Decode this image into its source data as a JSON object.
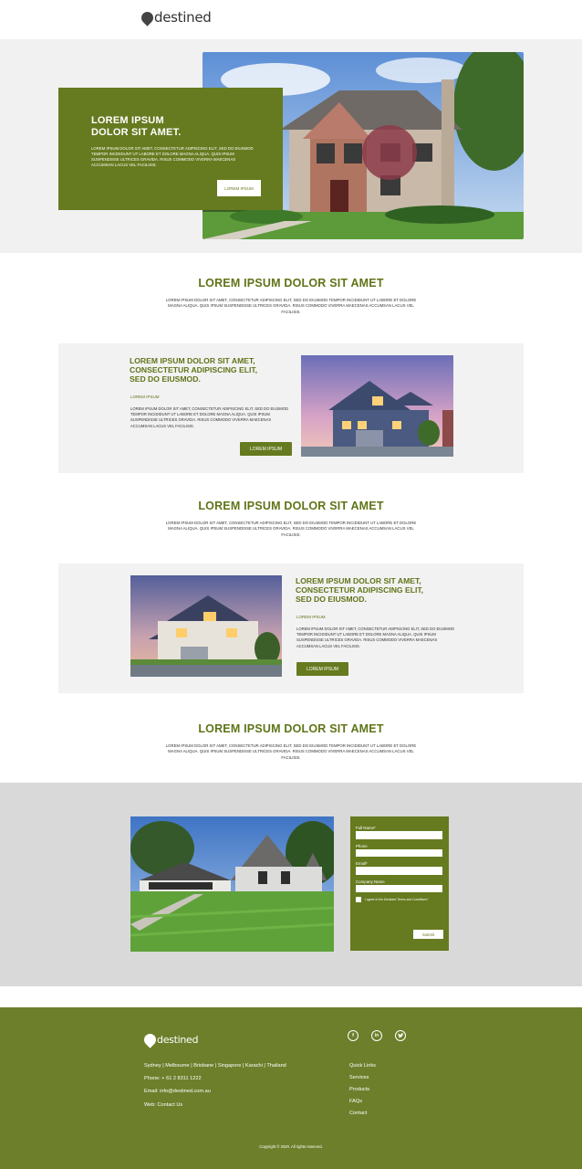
{
  "brand": {
    "logo_letter": "d",
    "logo_text": "estined",
    "color_primary": "#667a1f",
    "color_footer": "#6d7f2b"
  },
  "hero": {
    "title_line1": "LOREM IPSUM",
    "title_line2": "DOLOR SIT AMET.",
    "body": "LOREM IPSUM DOLOR SIT AMET, CONSECTETUR ADIPISCING ELIT, SED DO EIUSMOD TEMPOR INCIDIDUNT UT LABORE ET DOLORE MAGNA ALIQUA. QUIS IPSUM SUSPENDISSE ULTRICES GRAVIDA. RISUS COMMODO VIVERRA MAECENAS ACCUMSAN LACUS VEL FACILISIS.",
    "button": "LOREM IPSUM"
  },
  "section1": {
    "title": "LOREM IPSUM DOLOR SIT AMET",
    "body": "LOREM IPSUM DOLOR SIT AMET, CONSECTETUR ADIPISCING ELIT, SED DO EIUSMOD TEMPOR INCIDIDUNT UT LABORE ET DOLORE MAGNA ALIQUA. QUIS IPSUM SUSPENDISSE ULTRICES GRAVIDA. RISUS COMMODO VIVERRA MAECENAS ACCUMSAN LACUS VEL FACILISIS."
  },
  "feature1": {
    "heading": "LOREM IPSUM DOLOR SIT AMET, CONSECTETUR ADIPISCING ELIT, SED DO EIUSMOD.",
    "small": "LOREM IPSUM",
    "body": "LOREM IPSUM DOLOR SIT AMET, CONSECTETUR ADIPISCING ELIT, SED DO EIUSMOD TEMPOR INCIDIDUNT UT LABORE ET DOLORE MAGNA ALIQUA. QUIS IPSUM SUSPENDISSE ULTRICES GRAVIDA. RISUS COMMODO VIVERRA MAECENAS ACCUMSAN LACUS VEL FACILISIS.",
    "button": "LOREM IPSUM"
  },
  "section2": {
    "title": "LOREM IPSUM DOLOR SIT AMET",
    "body": "LOREM IPSUM DOLOR SIT AMET, CONSECTETUR ADIPISCING ELIT, SED DO EIUSMOD TEMPOR INCIDIDUNT UT LABORE ET DOLORE MAGNA ALIQUA. QUIS IPSUM SUSPENDISSE ULTRICES GRAVIDA. RISUS COMMODO VIVERRA MAECENAS ACCUMSAN LACUS VEL FACILISIS."
  },
  "feature2": {
    "heading": "LOREM IPSUM DOLOR SIT AMET, CONSECTETUR ADIPISCING ELIT, SED DO EIUSMOD.",
    "small": "LOREM IPSUM",
    "body": "LOREM IPSUM DOLOR SIT AMET, CONSECTETUR ADIPISCING ELIT, SED DO EIUSMOD TEMPOR INCIDIDUNT UT LABORE ET DOLORE MAGNA ALIQUA. QUIS IPSUM SUSPENDISSE ULTRICES GRAVIDA. RISUS COMMODO VIVERRA MAECENAS ACCUMSAN LACUS VEL FACILISIS.",
    "button": "LOREM IPSUM"
  },
  "section3": {
    "title": "LOREM IPSUM DOLOR SIT AMET",
    "body": "LOREM IPSUM DOLOR SIT AMET, CONSECTETUR ADIPISCING ELIT, SED DO EIUSMOD TEMPOR INCIDIDUNT UT LABORE ET DOLORE MAGNA ALIQUA. QUIS IPSUM SUSPENDISSE ULTRICES GRAVIDA. RISUS COMMODO VIVERRA MAECENAS ACCUMSAN LACUS VEL FACILISIS."
  },
  "form": {
    "full_name_label": "Full Name*",
    "phone_label": "Phone",
    "email_label": "Email*",
    "company_label": "Company Name",
    "terms_label": "I agree to the  Destined Terms and Conditions*",
    "submit": "Submit"
  },
  "footer": {
    "locations": "Sydney | Melbourne | Brisbane | Singapore | Karachi | Thailand",
    "phone": "Phone: + 61 2 8311 1222",
    "email": "Email: info@destined.com.au",
    "web": "Web: Contact Us",
    "links": [
      "Quick Links",
      "Services",
      "Products",
      "FAQs",
      "Contact"
    ],
    "social_icons": [
      "facebook-icon",
      "linkedin-icon",
      "twitter-icon"
    ],
    "copyright": "Copyright © 2020. All rights reserved."
  }
}
